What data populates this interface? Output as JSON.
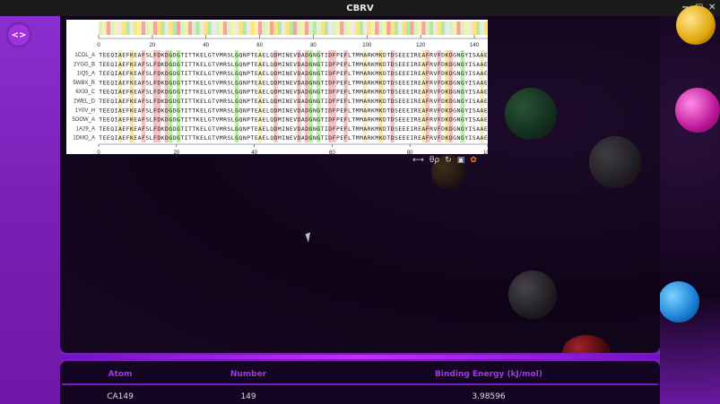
{
  "window": {
    "title": "CBRV",
    "controls": [
      "−",
      "□",
      "✕"
    ]
  },
  "nav_toggle": {
    "label": "<>"
  },
  "msa": {
    "conservation_colors": [
      "#d7f0c8",
      "#b9e79f",
      "#f5a2a2",
      "#ffe27a",
      "#f7f2a5",
      "#e9e9e9"
    ],
    "top_ruler": {
      "max": 145,
      "tick_labels": [
        "0",
        "20",
        "40",
        "60",
        "80",
        "100",
        "120",
        "140"
      ]
    },
    "bottom_ruler": {
      "max": 100,
      "tick_labels": [
        "0",
        "20",
        "40",
        "60",
        "80",
        "100"
      ]
    },
    "sequence_names": [
      "1CDL_A",
      "2YGG_B",
      "1IQ5_A",
      "5WBX_R",
      "6X33_C",
      "2WEL_D",
      "1Y0V_H",
      "5OOW_A",
      "1A29_A",
      "1DMO_A"
    ],
    "sequence": "TEEQIAEFKEAFSLFDKDGDGTITTKELGTVMRSLGQNPTEAELQDMINEVDADGNGTIDFPEFLTMMARKMKDTDSEEEIREAFRVFDKDGNGYISAAE",
    "toolbar_icons": [
      "resize-icon",
      "zoom-icon",
      "refresh-icon",
      "save-icon",
      "color-scheme-icon"
    ],
    "toolbar_glyphs": [
      "⟷",
      "θρ",
      "↻",
      "▣",
      "✿"
    ]
  },
  "binding_table": {
    "headers": [
      "Atom",
      "Number",
      "Binding Energy (kJ/mol)"
    ],
    "rows": [
      [
        "CA149",
        "149",
        "3.98596"
      ]
    ]
  },
  "accent_colors": {
    "purple": "#a435e8",
    "header_bar": "#1b1b1b"
  }
}
